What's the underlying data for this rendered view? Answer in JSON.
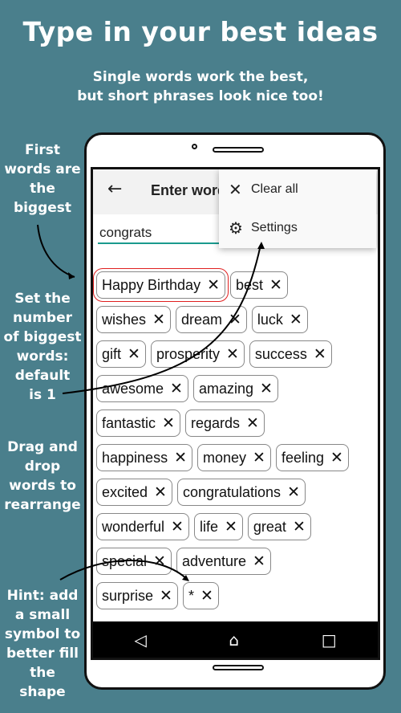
{
  "headline": "Type in your best ideas",
  "subheadline": [
    "Single words work the best,",
    "but short phrases look nice too!"
  ],
  "notes": {
    "first": [
      "First",
      "words are",
      "the",
      "biggest"
    ],
    "number": [
      "Set the",
      "number",
      "of biggest",
      "words:",
      "default",
      "is 1"
    ],
    "drag": [
      "Drag and",
      "drop",
      "words to",
      "rearrange"
    ],
    "hint": [
      "Hint: add",
      "a small",
      "symbol to",
      "better fill",
      "the",
      "shape"
    ]
  },
  "app": {
    "title": "Enter words",
    "input_value": "congrats",
    "menu": {
      "clear_all": "Clear all",
      "settings": "Settings"
    },
    "chip_rows": [
      [
        "Happy Birthday",
        "best"
      ],
      [
        "wishes",
        "dream",
        "luck"
      ],
      [
        "gift",
        "prosperity",
        "success"
      ],
      [
        "awesome",
        "amazing"
      ],
      [
        "fantastic",
        "regards"
      ],
      [
        "happiness",
        "money",
        "feeling"
      ],
      [
        "excited",
        "congratulations"
      ],
      [
        "wonderful",
        "life",
        "great"
      ],
      [
        "special",
        "adventure"
      ],
      [
        "surprise",
        "*"
      ]
    ],
    "selected_chip": "Happy Birthday"
  },
  "colors": {
    "background": "#4a7f8c",
    "input_underline": "#1a9a8e",
    "selection": "#e02020"
  }
}
